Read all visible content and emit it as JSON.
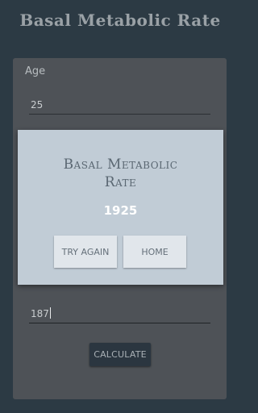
{
  "header": {
    "title": "Basal Metabolic Rate"
  },
  "form": {
    "age_label": "Age",
    "age_value": "25",
    "height_value": "187",
    "calculate_label": "CALCULATE"
  },
  "dialog": {
    "title_line1": "Basal Metabolic",
    "title_line2": "Rate",
    "result": "1925",
    "try_again_label": "TRY AGAIN",
    "home_label": "HOME"
  },
  "colors": {
    "background": "#2c3a44",
    "card": "#4e5257",
    "dialog": "#c1ccd6",
    "dialog_button": "#e1e6eb",
    "result_text": "#ffffff"
  }
}
